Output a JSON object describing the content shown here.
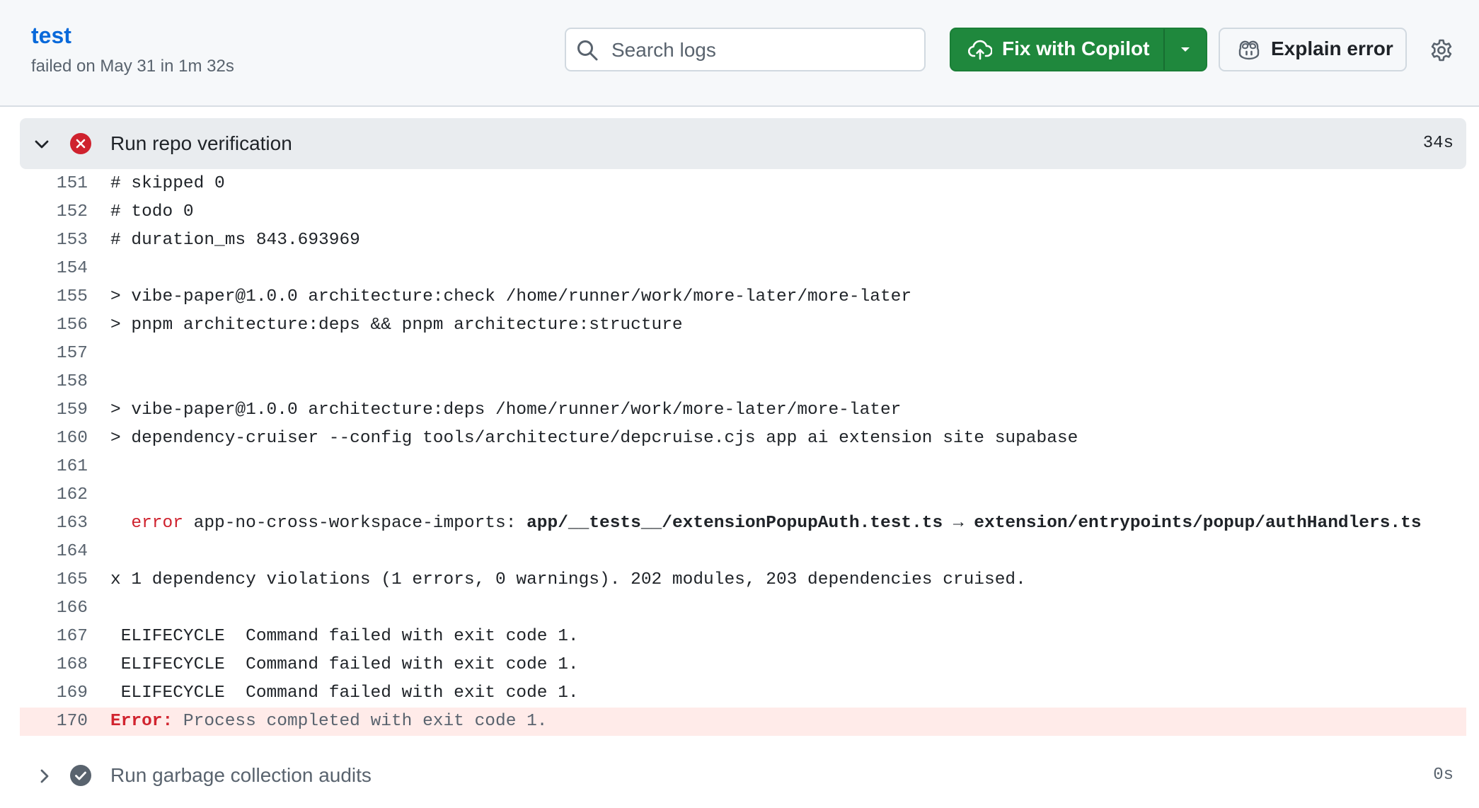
{
  "header": {
    "job_title": "test",
    "job_status": "failed on May 31 in 1m 32s",
    "search_placeholder": "Search logs",
    "fix_label": "Fix with Copilot",
    "explain_label": "Explain error"
  },
  "colors": {
    "primary_button": "#1f883d",
    "error": "#cf222e",
    "error_line_bg": "#ffebe9",
    "link": "#0969da",
    "success_icon": "#59636e"
  },
  "steps": [
    {
      "title": "Run repo verification",
      "duration": "34s",
      "status": "failed",
      "expanded": true
    },
    {
      "title": "Run garbage collection audits",
      "duration": "0s",
      "status": "succeeded",
      "expanded": false
    }
  ],
  "log_lines": [
    {
      "n": "151",
      "segments": [
        {
          "t": "# skipped 0"
        }
      ]
    },
    {
      "n": "152",
      "segments": [
        {
          "t": "# todo 0"
        }
      ]
    },
    {
      "n": "153",
      "segments": [
        {
          "t": "# duration_ms 843.693969"
        }
      ]
    },
    {
      "n": "154",
      "segments": []
    },
    {
      "n": "155",
      "segments": [
        {
          "t": "> vibe-paper@1.0.0 architecture:check /home/runner/work/more-later/more-later"
        }
      ]
    },
    {
      "n": "156",
      "segments": [
        {
          "t": "> pnpm architecture:deps && pnpm architecture:structure"
        }
      ]
    },
    {
      "n": "157",
      "segments": []
    },
    {
      "n": "158",
      "segments": []
    },
    {
      "n": "159",
      "segments": [
        {
          "t": "> vibe-paper@1.0.0 architecture:deps /home/runner/work/more-later/more-later"
        }
      ]
    },
    {
      "n": "160",
      "segments": [
        {
          "t": "> dependency-cruiser --config tools/architecture/depcruise.cjs app ai extension site supabase"
        }
      ]
    },
    {
      "n": "161",
      "segments": []
    },
    {
      "n": "162",
      "segments": []
    },
    {
      "n": "163",
      "segments": [
        {
          "t": "  "
        },
        {
          "t": "error",
          "c": "red"
        },
        {
          "t": " app-no-cross-workspace-imports: "
        },
        {
          "t": "app/__tests__/extensionPopupAuth.test.ts → extension/entrypoints/popup/authHandlers.ts",
          "c": "b"
        }
      ]
    },
    {
      "n": "164",
      "segments": []
    },
    {
      "n": "165",
      "segments": [
        {
          "t": "x 1 dependency violations (1 errors, 0 warnings). 202 modules, 203 dependencies cruised."
        }
      ]
    },
    {
      "n": "166",
      "segments": []
    },
    {
      "n": "167",
      "segments": [
        {
          "t": " ELIFECYCLE  Command failed with exit code 1."
        }
      ]
    },
    {
      "n": "168",
      "segments": [
        {
          "t": " ELIFECYCLE  Command failed with exit code 1."
        }
      ]
    },
    {
      "n": "169",
      "segments": [
        {
          "t": " ELIFECYCLE  Command failed with exit code 1."
        }
      ]
    },
    {
      "n": "170",
      "error": true,
      "segments": [
        {
          "t": "Error:",
          "c": "errbold"
        },
        {
          "t": " Process completed with exit code 1.",
          "c": "dim"
        }
      ]
    }
  ]
}
